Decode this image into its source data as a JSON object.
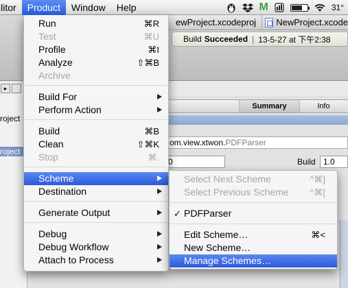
{
  "menubar": {
    "items": [
      {
        "label": "ilitor"
      },
      {
        "label": "Product"
      },
      {
        "label": "Window"
      },
      {
        "label": "Help"
      }
    ],
    "status": {
      "qq_icon": "penguin-icon",
      "dropbox_icon": "dropbox-icon",
      "m_icon_text": "M",
      "battery_level": 0.7,
      "weather_text": "31°"
    }
  },
  "xcode": {
    "tab1": "ewProject.xcodeproj",
    "tab2": "NewProject.xcode",
    "activity": {
      "prefix": "Build",
      "status": "Succeeded",
      "separator": "|",
      "timestamp": "13-5-27 at 下午2:38"
    },
    "navigator": {
      "row1": "roject",
      "row2": "roject"
    },
    "editor_tabs": {
      "summary": "Summary",
      "info": "Info"
    },
    "bundle_id": {
      "main": "om.view.xtwon.",
      "suffix": "PDFParser"
    },
    "version_value": "0",
    "build_label": "Build",
    "build_value": "1.0"
  },
  "product_menu": {
    "items": [
      {
        "label": "Run",
        "shortcut": "⌘R",
        "disabled": false
      },
      {
        "label": "Test",
        "shortcut": "⌘U",
        "disabled": true
      },
      {
        "label": "Profile",
        "shortcut": "⌘I",
        "disabled": false
      },
      {
        "label": "Analyze",
        "shortcut": "⇧⌘B",
        "disabled": false
      },
      {
        "label": "Archive",
        "shortcut": "",
        "disabled": true
      },
      {
        "label": "Build For",
        "submenu": true
      },
      {
        "label": "Perform Action",
        "submenu": true
      },
      {
        "label": "Build",
        "shortcut": "⌘B"
      },
      {
        "label": "Clean",
        "shortcut": "⇧⌘K"
      },
      {
        "label": "Stop",
        "shortcut": "⌘.",
        "disabled": true
      },
      {
        "label": "Scheme",
        "submenu": true,
        "highlighted": true
      },
      {
        "label": "Destination",
        "submenu": true
      },
      {
        "label": "Generate Output",
        "submenu": true
      },
      {
        "label": "Debug",
        "submenu": true
      },
      {
        "label": "Debug Workflow",
        "submenu": true
      },
      {
        "label": "Attach to Process",
        "submenu": true
      }
    ]
  },
  "scheme_menu": {
    "items": [
      {
        "label": "Select Next Scheme",
        "shortcut": "^⌘]",
        "disabled": true
      },
      {
        "label": "Select Previous Scheme",
        "shortcut": "^⌘[",
        "disabled": true
      },
      {
        "label": "PDFParser",
        "checked": true
      },
      {
        "label": "Edit Scheme…",
        "shortcut": "⌘<"
      },
      {
        "label": "New Scheme…"
      },
      {
        "label": "Manage Schemes…",
        "highlighted": true
      }
    ],
    "checkmark": "✓"
  }
}
